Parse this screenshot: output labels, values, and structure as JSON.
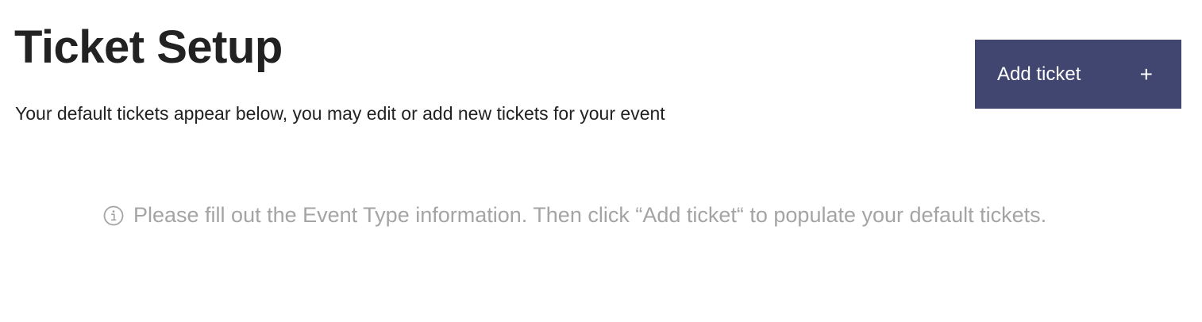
{
  "header": {
    "title": "Ticket Setup",
    "subtitle": "Your default tickets appear below, you may edit or add new tickets for your event"
  },
  "actions": {
    "add_ticket_label": "Add ticket",
    "add_ticket_icon": "plus-icon",
    "add_ticket_symbol": "+"
  },
  "notice": {
    "icon": "info-icon",
    "text": "Please fill out the Event Type information. Then click “Add ticket“ to populate your default tickets."
  },
  "colors": {
    "button_bg": "#414670",
    "button_text": "#ffffff",
    "title_text": "#222222",
    "notice_text": "#a4a4a4"
  }
}
